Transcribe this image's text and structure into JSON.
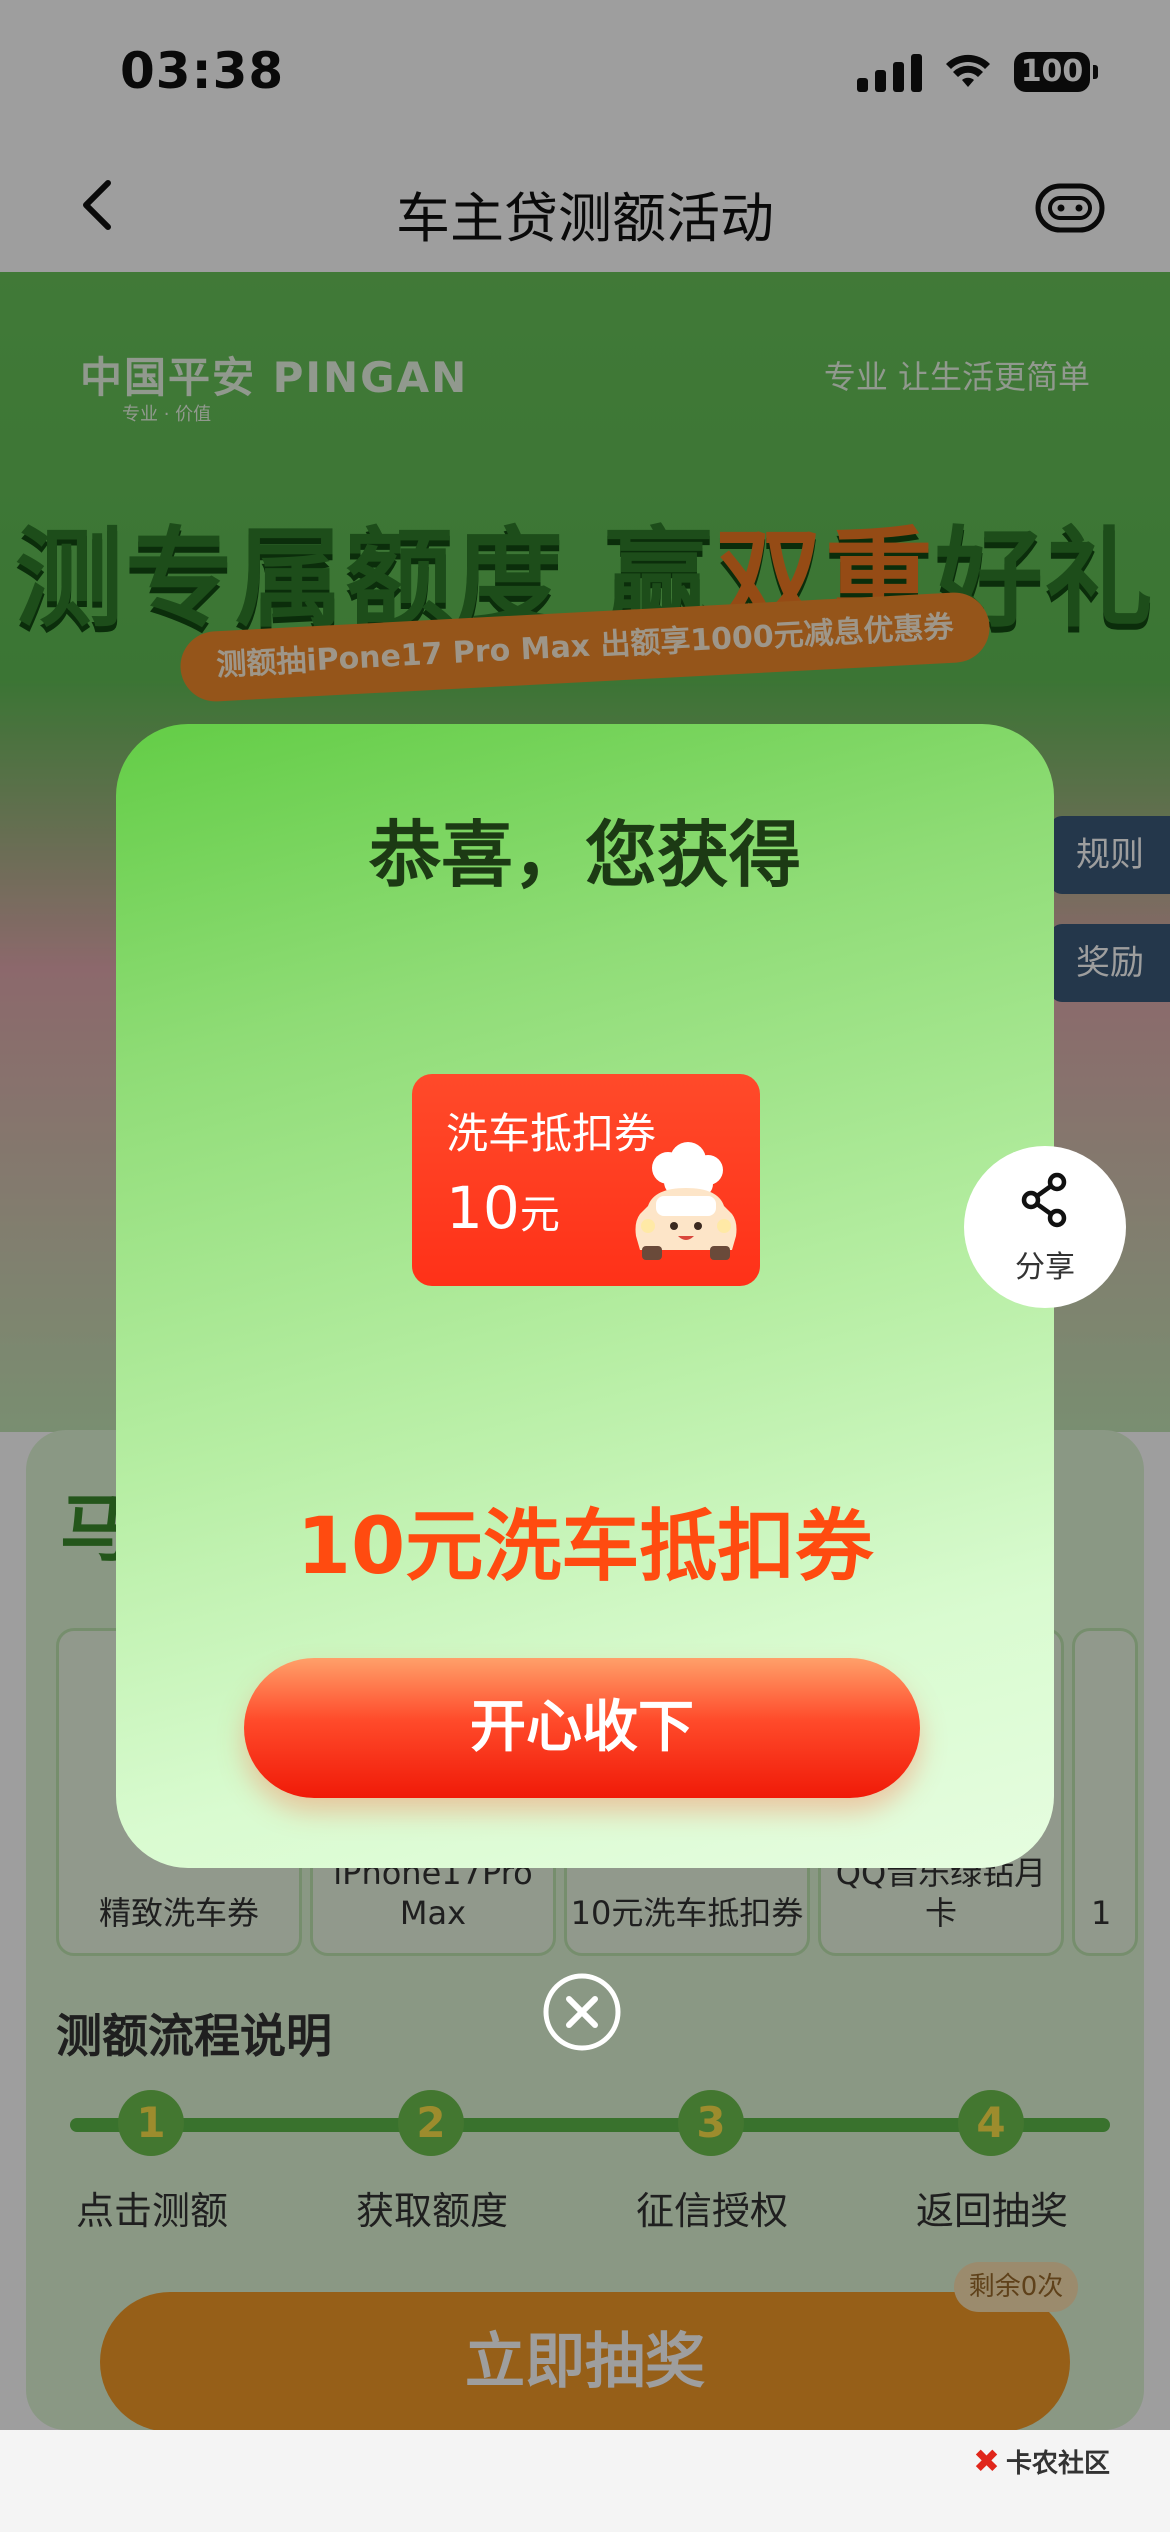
{
  "status_bar": {
    "time": "03:38",
    "battery": "100"
  },
  "nav": {
    "title": "车主贷测额活动"
  },
  "hero": {
    "brand": "中国平安 PINGAN",
    "brand_sub": "专业 · 价值",
    "slogan": "专业 让生活更简单",
    "headline_main": "测专属额度 赢",
    "headline_accent": "双重",
    "headline_tail": "好礼",
    "ribbon_text": "测额抽iPone17 Pro Max  出额享1000元减息优惠券"
  },
  "side_tabs": {
    "rules": "规则",
    "rewards": "奖励"
  },
  "prize_section": {
    "heading": "马",
    "items": [
      "精致洗车券",
      "iPhone17Pro Max",
      "10元洗车抵扣券",
      "QQ音乐绿钻月卡",
      "1"
    ]
  },
  "flow": {
    "title": "测额流程说明",
    "steps": [
      {
        "num": "1",
        "label": "点击测额"
      },
      {
        "num": "2",
        "label": "获取额度"
      },
      {
        "num": "3",
        "label": "征信授权"
      },
      {
        "num": "4",
        "label": "返回抽奖"
      }
    ]
  },
  "draw": {
    "label": "立即抽奖",
    "remaining": "剩余0次"
  },
  "watermark": "卡农社区",
  "modal": {
    "title": "恭喜，您获得",
    "coupon_name": "洗车抵扣券",
    "coupon_amount": "10",
    "coupon_unit": "元",
    "prize_name": "10元洗车抵扣券",
    "accept_label": "开心收下"
  },
  "share": {
    "label": "分享"
  },
  "colors": {
    "accent_orange": "#ff4b10",
    "modal_green": "#63cd46",
    "button_red": "#f01a08"
  }
}
